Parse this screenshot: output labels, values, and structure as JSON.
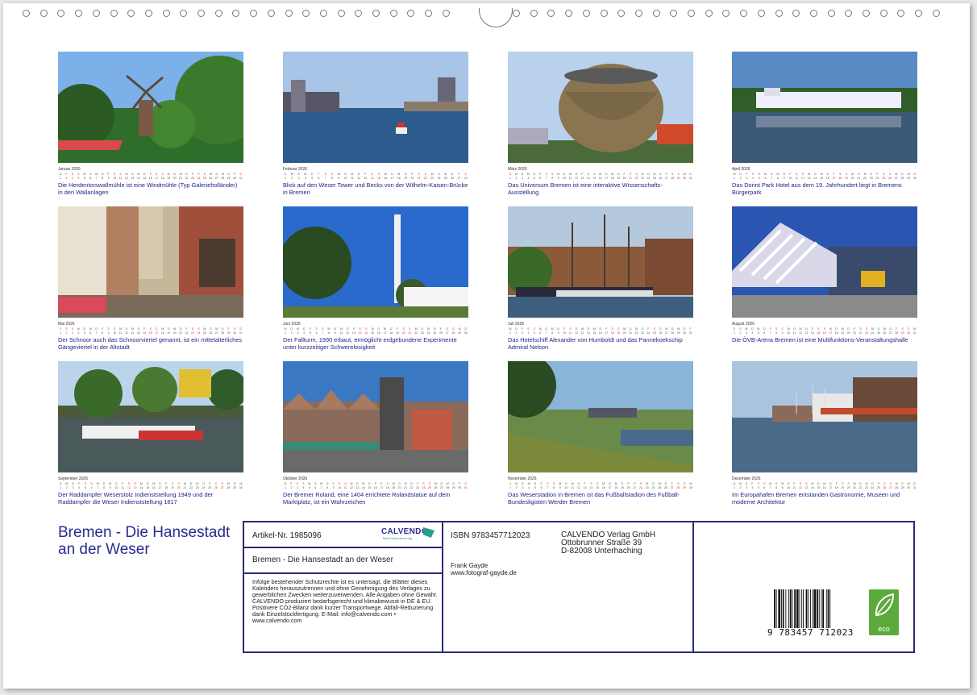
{
  "document": {
    "title": "Bremen - Die Hansestadt an der Weser",
    "year": "2026",
    "weekday_letters": [
      "D",
      "M",
      "D",
      "F",
      "S",
      "S",
      "M",
      "D",
      "M",
      "D",
      "F",
      "S",
      "S",
      "M",
      "D",
      "M",
      "D",
      "F",
      "S",
      "S",
      "M",
      "D",
      "M",
      "D",
      "F",
      "S",
      "S",
      "M",
      "D",
      "M",
      "D"
    ],
    "months": [
      {
        "name": "Januar 2026",
        "days": 31,
        "caption": "Die Herdentorswallmühle ist eine Windmühle (Typ Galerieholländer) in den Wallanlagen"
      },
      {
        "name": "Februar 2026",
        "days": 28,
        "caption": "Blick auf den Weser Tower und Becks von der Wilhelm-Kaisen-Brücke in Bremen"
      },
      {
        "name": "März 2026",
        "days": 31,
        "caption": "Das Universum Bremen ist eine interaktive Wissenschafts-Ausstellung"
      },
      {
        "name": "April 2026",
        "days": 30,
        "caption": "Das Dorint Park Hotel aus dem 19. Jahrhundert liegt in Bremens Bürgerpark"
      },
      {
        "name": "Mai 2026",
        "days": 31,
        "caption": "Der Schnoor auch das Schnoorviertel genannt, ist ein mittelalterliches Gängeviertel in der Altstadt"
      },
      {
        "name": "Juni 2026",
        "days": 30,
        "caption": "Der Fallturm, 1990 erbaut, ermöglicht erdgebundene Experimente unter kurzzeitiger Schwerelosigkeit"
      },
      {
        "name": "Juli 2026",
        "days": 31,
        "caption": "Das Hotelschiff Alexander von Humboldt und das Pannekoekschip Admiral Nelson"
      },
      {
        "name": "August 2026",
        "days": 31,
        "caption": "Die ÖVB-Arena Bremen ist eine Multifunktions-Veranstaltungshalle"
      },
      {
        "name": "September 2026",
        "days": 30,
        "caption": "Der Raddampfer Weserstolz Indienststellung 1949 und der Raddampfer die Weser Indienststellung 1817"
      },
      {
        "name": "Oktober 2026",
        "days": 31,
        "caption": "Der Bremer Roland, eine 1404 errichtete Rolandstatue auf dem Marktplatz, ist ein Wahrzeichen"
      },
      {
        "name": "November 2026",
        "days": 30,
        "caption": "Das Weserstadion in Bremen ist das Fußballstadion des Fußball-Bundesligisten Werder Bremen"
      },
      {
        "name": "Dezember 2026",
        "days": 31,
        "caption": "Im Europahafen Bremen entstanden Gastronomie, Museen und moderne Architektur"
      }
    ]
  },
  "info": {
    "article_no": "Artikel-Nr. 1985096",
    "calvendo_logo": "CALVENDO",
    "calvendo_tagline": "Best Kalenderverlag",
    "box_title": "Bremen - Die Hansestadt an der Weser",
    "legal_text": "Infolge bestehender Schutzrechte ist es untersagt, die Blätter dieses Kalenders herauszutrennen und ohne Genehmigung des Verlages zu gewerblichen Zwecken weiterzuverwenden. Alle Angaben ohne Gewähr. CALVENDO produziert bedarfsgerecht und klimabewusst in DE & EU. Positivere CO2-Bilanz dank kurzer Transportwege. Abfall-Reduzierung dank Einzelstückfertigung. E-Mail: info@calvendo.com • www.calvendo.com",
    "isbn": "ISBN 9783457712023",
    "publisher_name": "CALVENDO Verlag GmbH",
    "publisher_street": "Ottobrunner Straße 39",
    "publisher_city": "D-82008 Unterhaching",
    "author": "Frank Gayde",
    "author_web": "www.fotograf-gayde.de",
    "barcode_number": "9  783457  712023",
    "eco_label": "eco"
  },
  "colors": {
    "accent": "#2a2d8f",
    "caption": "#24228a",
    "eco": "#5ca93c"
  }
}
